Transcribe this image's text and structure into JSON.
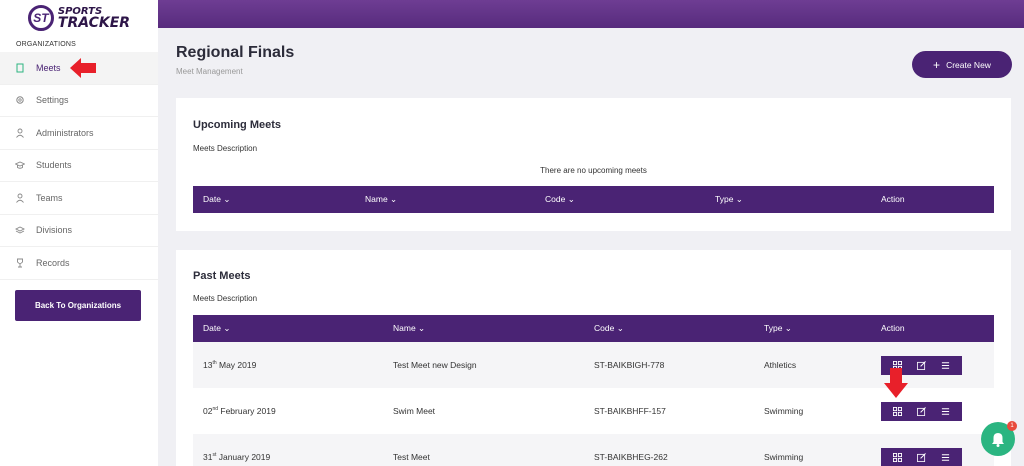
{
  "brand": {
    "line1": "SPORTS",
    "line2": "TRACKER",
    "mark": "ST"
  },
  "sidebar": {
    "section_label": "ORGANIZATIONS",
    "items": [
      {
        "label": "Meets",
        "icon": "book-icon",
        "active": true
      },
      {
        "label": "Settings",
        "icon": "gear-icon"
      },
      {
        "label": "Administrators",
        "icon": "user-icon"
      },
      {
        "label": "Students",
        "icon": "graduation-cap-icon"
      },
      {
        "label": "Teams",
        "icon": "team-icon"
      },
      {
        "label": "Divisions",
        "icon": "layers-icon"
      },
      {
        "label": "Records",
        "icon": "trophy-icon"
      }
    ],
    "back_button": "Back To Organizations"
  },
  "header": {
    "title": "Regional Finals",
    "subtitle": "Meet Management",
    "create_button": "Create New"
  },
  "upcoming": {
    "title": "Upcoming Meets",
    "description": "Meets Description",
    "empty_message": "There are no upcoming meets",
    "columns": [
      "Date",
      "Name",
      "Code",
      "Type",
      "Action"
    ]
  },
  "past": {
    "title": "Past Meets",
    "description": "Meets Description",
    "columns": [
      "Date",
      "Name",
      "Code",
      "Type",
      "Action"
    ],
    "rows": [
      {
        "day": "13",
        "suffix": "th",
        "rest": " May 2019",
        "name": "Test Meet new Design",
        "code": "ST-BAIKBIGH-778",
        "type": "Athletics"
      },
      {
        "day": "02",
        "suffix": "nd",
        "rest": " February 2019",
        "name": "Swim Meet",
        "code": "ST-BAIKBHFF-157",
        "type": "Swimming"
      },
      {
        "day": "31",
        "suffix": "st",
        "rest": " January 2019",
        "name": "Test Meet",
        "code": "ST-BAIKBHEG-262",
        "type": "Swimming"
      }
    ]
  },
  "notifications": {
    "count": "1"
  },
  "colors": {
    "primary": "#4a2374",
    "annotation_arrow": "#e8202a",
    "bell": "#2bb581"
  }
}
